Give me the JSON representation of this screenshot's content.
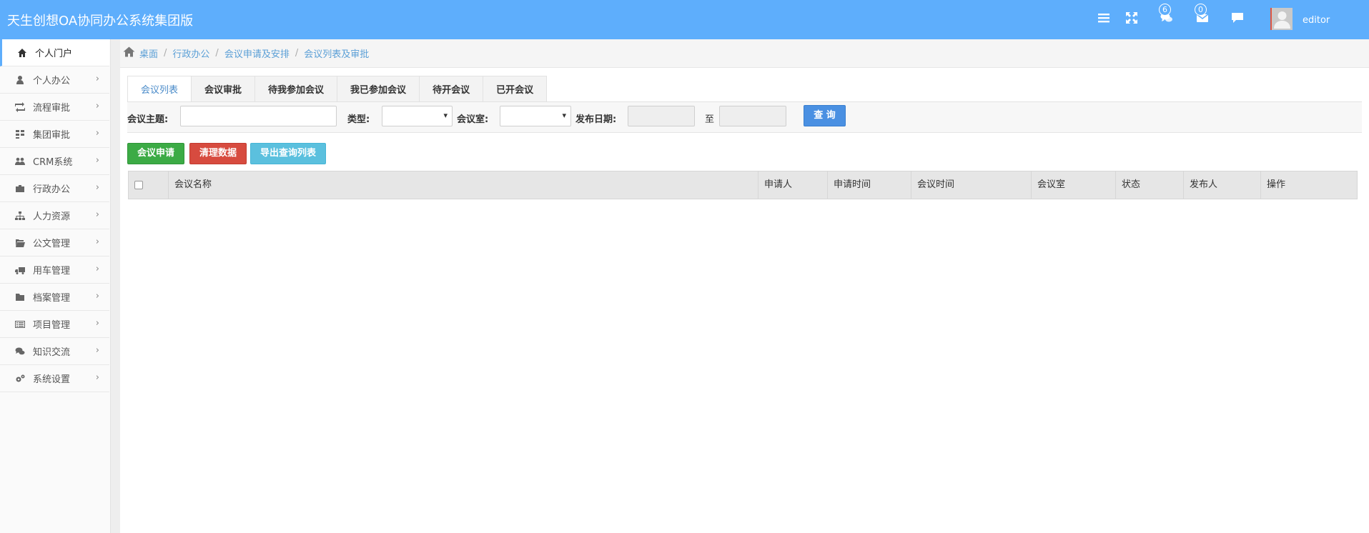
{
  "app": {
    "title": "天生创想OA协同办公系统集团版"
  },
  "topbar": {
    "chat_badge": "6",
    "mail_badge": "0",
    "user_name": "editor"
  },
  "sidebar": {
    "items": [
      {
        "label": "个人门户",
        "icon": "home-icon",
        "active": true
      },
      {
        "label": "个人办公",
        "icon": "user-icon"
      },
      {
        "label": "流程审批",
        "icon": "retweet-icon"
      },
      {
        "label": "集团审批",
        "icon": "grid-icon"
      },
      {
        "label": "CRM系统",
        "icon": "users-icon"
      },
      {
        "label": "行政办公",
        "icon": "briefcase-icon"
      },
      {
        "label": "人力资源",
        "icon": "sitemap-icon"
      },
      {
        "label": "公文管理",
        "icon": "folder-open-icon"
      },
      {
        "label": "用车管理",
        "icon": "truck-icon"
      },
      {
        "label": "档案管理",
        "icon": "folder-icon"
      },
      {
        "label": "项目管理",
        "icon": "list-icon"
      },
      {
        "label": "知识交流",
        "icon": "comments-icon"
      },
      {
        "label": "系统设置",
        "icon": "cogs-icon"
      }
    ],
    "arrow": "›"
  },
  "breadcrumb": {
    "items": [
      "桌面",
      "行政办公",
      "会议申请及安排",
      "会议列表及审批"
    ],
    "separator": "/"
  },
  "tabs": [
    "会议列表",
    "会议审批",
    "待我参加会议",
    "我已参加会议",
    "待开会议",
    "已开会议"
  ],
  "filter": {
    "subject_label": "会议主题:",
    "type_label": "类型:",
    "room_label": "会议室:",
    "date_label": "发布日期:",
    "to_label": "至",
    "query_button": "查 询"
  },
  "actions": {
    "apply": "会议申请",
    "clear": "清理数据",
    "export": "导出查询列表"
  },
  "table": {
    "columns": [
      "会议名称",
      "申请人",
      "申请时间",
      "会议时间",
      "会议室",
      "状态",
      "发布人",
      "操作"
    ],
    "rows": []
  },
  "colors": {
    "topbar": "#5eaefc",
    "primary": "#4a90e2",
    "success": "#3cab45",
    "danger": "#d74b3f",
    "info": "#5bc0de"
  }
}
